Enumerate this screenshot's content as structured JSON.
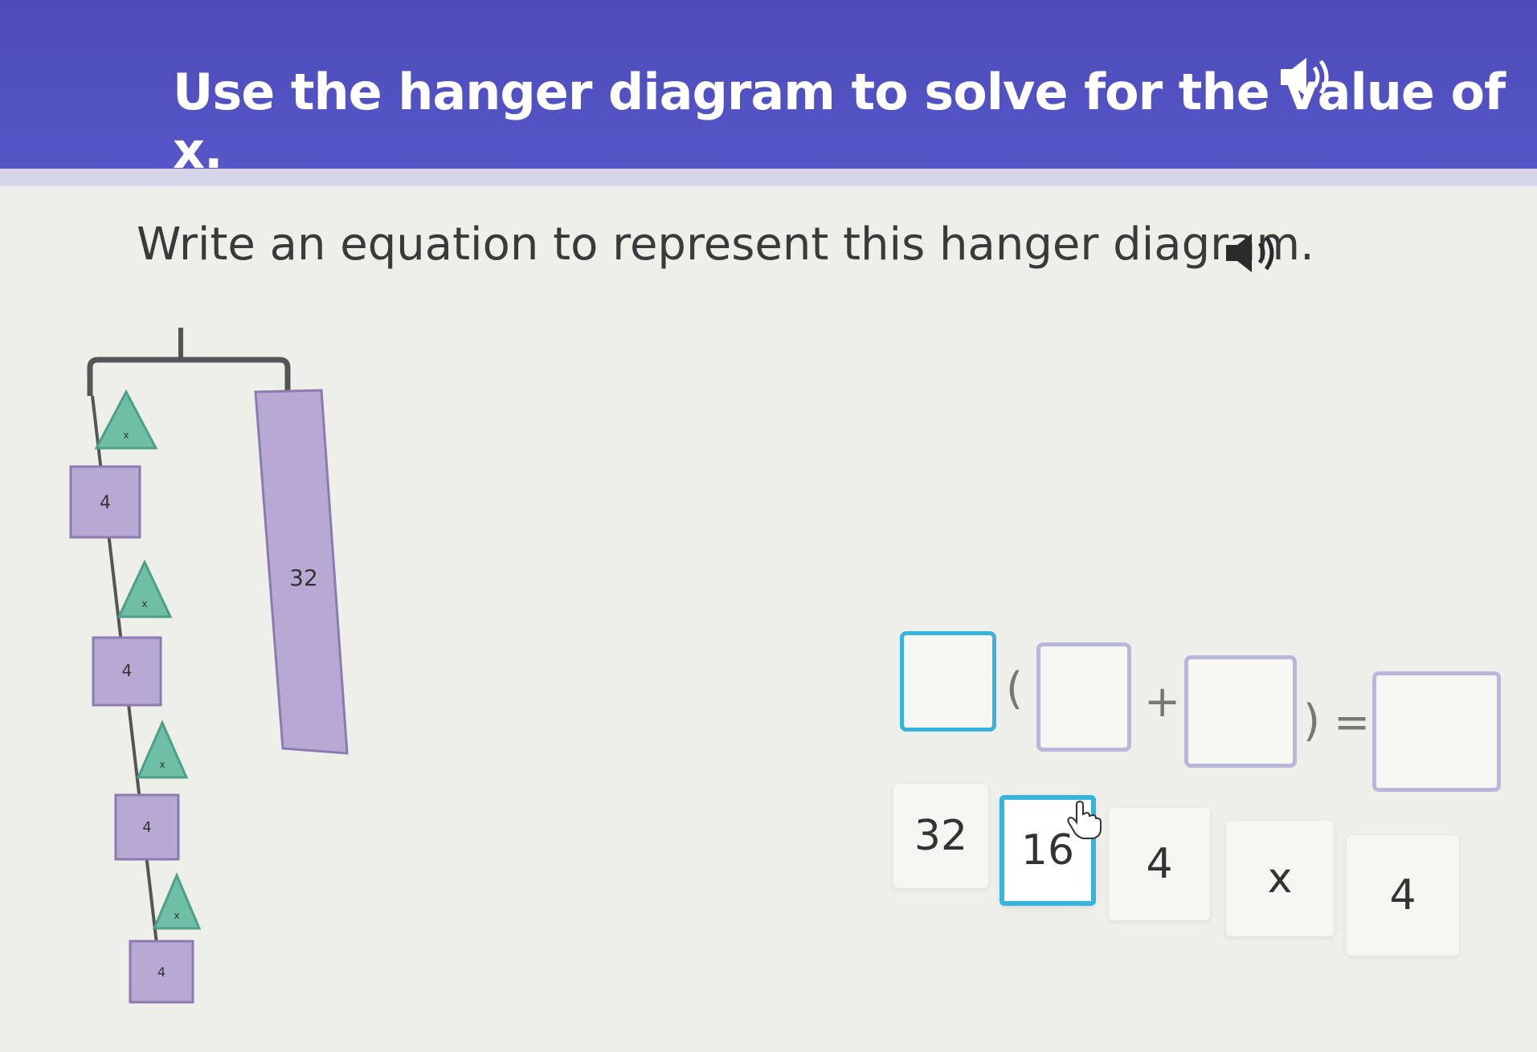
{
  "header": {
    "title": "Use the hanger diagram to solve for the value of x.",
    "speaker_icon": "speaker-icon"
  },
  "question": {
    "prompt": "Write an equation to represent this hanger diagram.",
    "speaker_icon": "speaker-icon"
  },
  "hanger": {
    "left_weights": [
      {
        "shape": "triangle",
        "label": "x"
      },
      {
        "shape": "square",
        "label": "4"
      },
      {
        "shape": "triangle",
        "label": "x"
      },
      {
        "shape": "square",
        "label": "4"
      },
      {
        "shape": "triangle",
        "label": "x"
      },
      {
        "shape": "square",
        "label": "4"
      },
      {
        "shape": "triangle",
        "label": "x"
      },
      {
        "shape": "square",
        "label": "4"
      }
    ],
    "right_weight": {
      "shape": "rectangle",
      "label": "32"
    },
    "colors": {
      "triangle": "#6fbfa7",
      "square": "#b8a8d4",
      "bar": "#555555"
    }
  },
  "equation": {
    "open_paren": "(",
    "plus": "+",
    "close_paren": ")",
    "equals": "="
  },
  "tiles": [
    {
      "label": "32",
      "selected": false
    },
    {
      "label": "16",
      "selected": true
    },
    {
      "label": "4",
      "selected": false
    },
    {
      "label": "x",
      "selected": false
    },
    {
      "label": "4",
      "selected": false
    }
  ],
  "colors": {
    "banner": "#5252c2",
    "accent": "#38b4dc",
    "slot_border": "#b9b6dc"
  }
}
